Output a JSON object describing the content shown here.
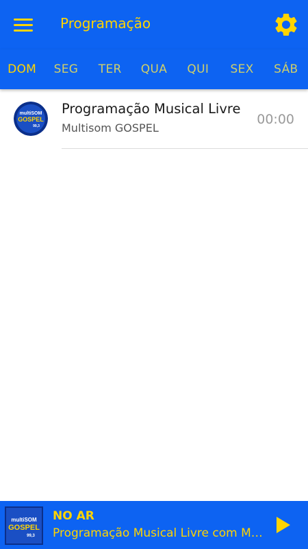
{
  "header": {
    "title": "Programação",
    "menu_icon": "hamburger-menu-icon",
    "settings_icon": "gear-icon",
    "accent_color": "#ffd400",
    "bar_color": "#0d63f2"
  },
  "tabs": [
    {
      "label": "DOM",
      "active": true
    },
    {
      "label": "SEG",
      "active": false
    },
    {
      "label": "TER",
      "active": false
    },
    {
      "label": "QUA",
      "active": false
    },
    {
      "label": "QUI",
      "active": false
    },
    {
      "label": "SEX",
      "active": false
    },
    {
      "label": "SÁB",
      "active": false
    }
  ],
  "programs": [
    {
      "title": "Programação Musical Livre",
      "subtitle": "Multisom GOSPEL",
      "time": "00:00",
      "logo": {
        "line1": "multiSOM",
        "line2": "GOSPEL",
        "line3": "99,3"
      }
    }
  ],
  "player": {
    "status": "NO AR",
    "now_playing": "Programação Musical Livre com Multisom GOSPEL",
    "play_icon": "play-icon",
    "logo": {
      "line1": "multiSOM",
      "line2": "GOSPEL",
      "line3": "99,3"
    }
  }
}
